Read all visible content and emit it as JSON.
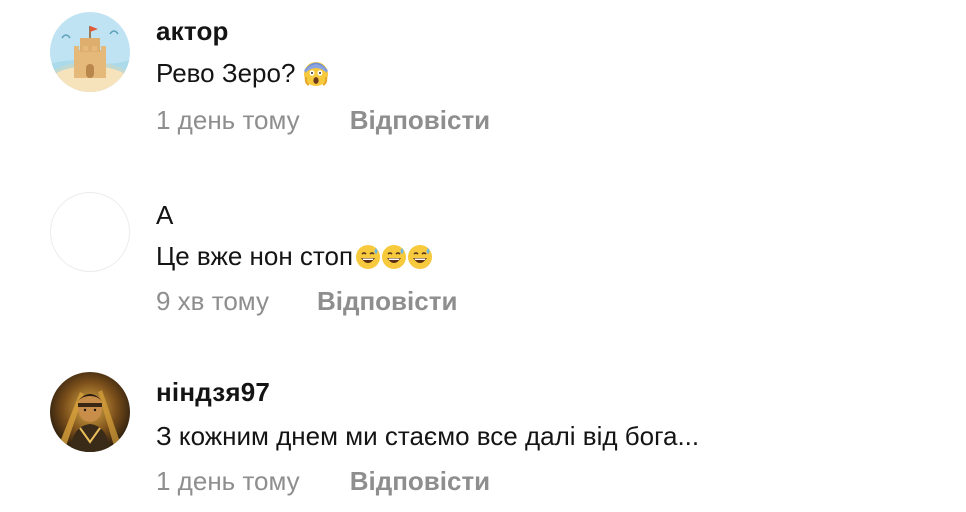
{
  "comments": [
    {
      "author": "актор",
      "text": "Рево Зеро?",
      "emojis": [
        "scream-emoji"
      ],
      "time": "1 день тому",
      "reply_label": "Відповісти",
      "avatar": "sandcastle-avatar"
    },
    {
      "author": "А",
      "text": "Це вже нон стоп",
      "emojis": [
        "sweat-smile-emoji",
        "sweat-smile-emoji",
        "sweat-smile-emoji"
      ],
      "time": "9 хв тому",
      "reply_label": "Відповісти",
      "avatar": "blank-avatar"
    },
    {
      "author": "ніндзя97",
      "text": "З кожним днем ми стаємо все далі від бога...",
      "emojis": [],
      "time": "1 день тому",
      "reply_label": "Відповісти",
      "avatar": "ninja-avatar"
    }
  ],
  "colors": {
    "text": "#141414",
    "muted": "#8e8e8e",
    "background": "#ffffff"
  }
}
